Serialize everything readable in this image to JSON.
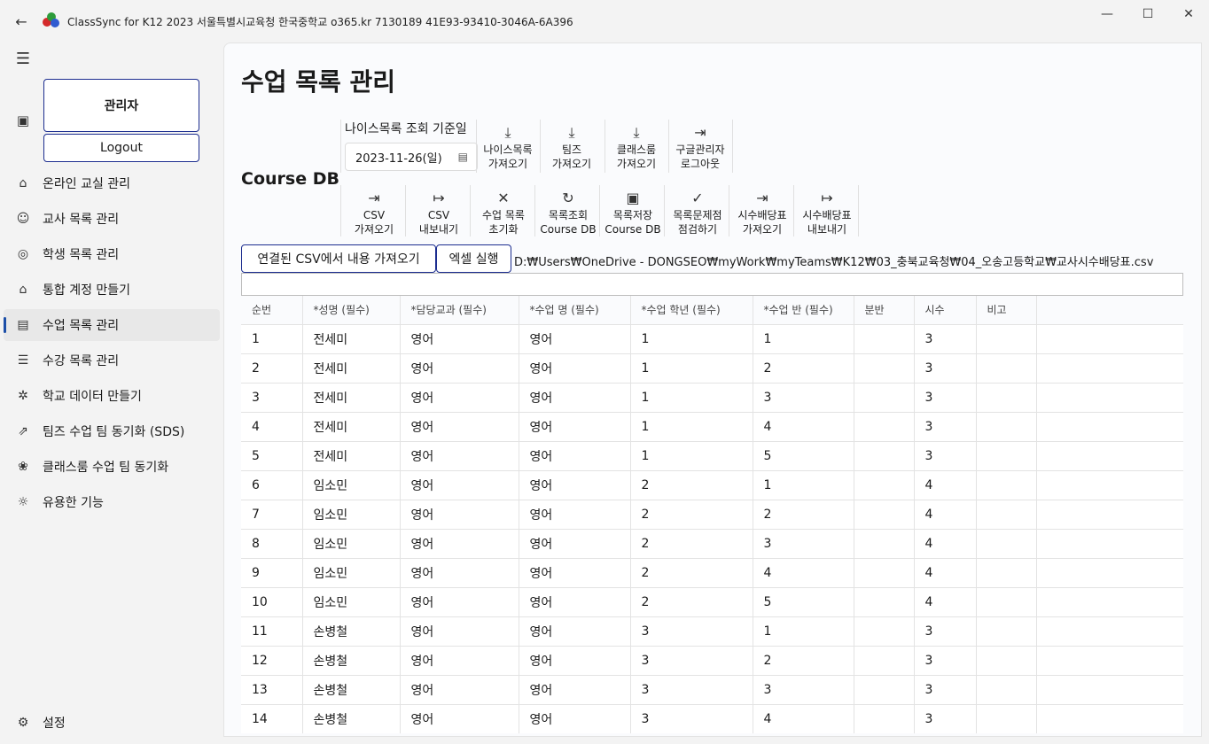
{
  "window": {
    "title": "ClassSync for K12 2023 서울특별시교육청 한국중학교 o365.kr 7130189 41E93-93410-3046A-6A396",
    "minimize_glyph": "—",
    "maximize_glyph": "☐",
    "close_glyph": "✕"
  },
  "sidebar": {
    "admin_label": "관리자",
    "logout_label": "Logout",
    "items": [
      {
        "label": "온라인 교실 관리",
        "icon": "home-icon"
      },
      {
        "label": "교사 목록 관리",
        "icon": "teacher-icon"
      },
      {
        "label": "학생 목록 관리",
        "icon": "student-icon"
      },
      {
        "label": "통합 계정 만들기",
        "icon": "graduation-cap-icon"
      },
      {
        "label": "수업 목록 관리",
        "icon": "class-list-icon"
      },
      {
        "label": "수강 목록 관리",
        "icon": "checklist-icon"
      },
      {
        "label": "학교 데이터 만들기",
        "icon": "gears-icon"
      },
      {
        "label": "팀즈 수업 팀 동기화 (SDS)",
        "icon": "share-icon"
      },
      {
        "label": "클래스룸 수업 팀 동기화",
        "icon": "people-icon"
      },
      {
        "label": "유용한 기능",
        "icon": "lightbulb-icon"
      }
    ],
    "settings_label": "설정"
  },
  "main": {
    "title": "수업 목록 관리",
    "section_label": "Course DB",
    "neis_date_label": "나이스목록 조회 기준일",
    "neis_date_value": "2023-11-26(일)",
    "top_tools": [
      {
        "label": "나이스목록\n가져오기",
        "icon": "download-icon"
      },
      {
        "label": "팀즈\n가져오기",
        "icon": "download-icon"
      },
      {
        "label": "클래스룸\n가져오기",
        "icon": "download-icon"
      },
      {
        "label": "구글관리자\n로그아웃",
        "icon": "logout-icon"
      }
    ],
    "bottom_tools": [
      {
        "label": "CSV\n가져오기",
        "icon": "import-icon"
      },
      {
        "label": "CSV\n내보내기",
        "icon": "export-icon"
      },
      {
        "label": "수업 목록\n초기화",
        "icon": "close-icon"
      },
      {
        "label": "목록조회\nCourse DB",
        "icon": "refresh-icon"
      },
      {
        "label": "목록저장\nCourse DB",
        "icon": "save-icon"
      },
      {
        "label": "목록문제점\n점검하기",
        "icon": "check-icon"
      },
      {
        "label": "시수배당표\n가져오기",
        "icon": "import-icon"
      },
      {
        "label": "시수배당표\n내보내기",
        "icon": "export-icon"
      }
    ],
    "import_csv_button": "연결된 CSV에서 내용 가져오기",
    "excel_button": "엑셀 실행",
    "csv_path": "D:₩Users₩OneDrive - DONGSEO₩myWork₩myTeams₩K12₩03_충북교육청₩04_오송고등학교₩교사시수배당표.csv",
    "input_value": ""
  },
  "table": {
    "columns": [
      "순번",
      "*성명 (필수)",
      "*담당교과 (필수)",
      "*수업 명 (필수)",
      "*수업 학년 (필수)",
      "*수업 반 (필수)",
      "분반",
      "시수",
      "비고",
      ""
    ],
    "rows": [
      [
        "1",
        "전세미",
        "영어",
        "영어",
        "1",
        "1",
        "",
        "3",
        "",
        ""
      ],
      [
        "2",
        "전세미",
        "영어",
        "영어",
        "1",
        "2",
        "",
        "3",
        "",
        ""
      ],
      [
        "3",
        "전세미",
        "영어",
        "영어",
        "1",
        "3",
        "",
        "3",
        "",
        ""
      ],
      [
        "4",
        "전세미",
        "영어",
        "영어",
        "1",
        "4",
        "",
        "3",
        "",
        ""
      ],
      [
        "5",
        "전세미",
        "영어",
        "영어",
        "1",
        "5",
        "",
        "3",
        "",
        ""
      ],
      [
        "6",
        "임소민",
        "영어",
        "영어",
        "2",
        "1",
        "",
        "4",
        "",
        ""
      ],
      [
        "7",
        "임소민",
        "영어",
        "영어",
        "2",
        "2",
        "",
        "4",
        "",
        ""
      ],
      [
        "8",
        "임소민",
        "영어",
        "영어",
        "2",
        "3",
        "",
        "4",
        "",
        ""
      ],
      [
        "9",
        "임소민",
        "영어",
        "영어",
        "2",
        "4",
        "",
        "4",
        "",
        ""
      ],
      [
        "10",
        "임소민",
        "영어",
        "영어",
        "2",
        "5",
        "",
        "4",
        "",
        ""
      ],
      [
        "11",
        "손병철",
        "영어",
        "영어",
        "3",
        "1",
        "",
        "3",
        "",
        ""
      ],
      [
        "12",
        "손병철",
        "영어",
        "영어",
        "3",
        "2",
        "",
        "3",
        "",
        ""
      ],
      [
        "13",
        "손병철",
        "영어",
        "영어",
        "3",
        "3",
        "",
        "3",
        "",
        ""
      ],
      [
        "14",
        "손병철",
        "영어",
        "영어",
        "3",
        "4",
        "",
        "3",
        "",
        ""
      ]
    ]
  }
}
